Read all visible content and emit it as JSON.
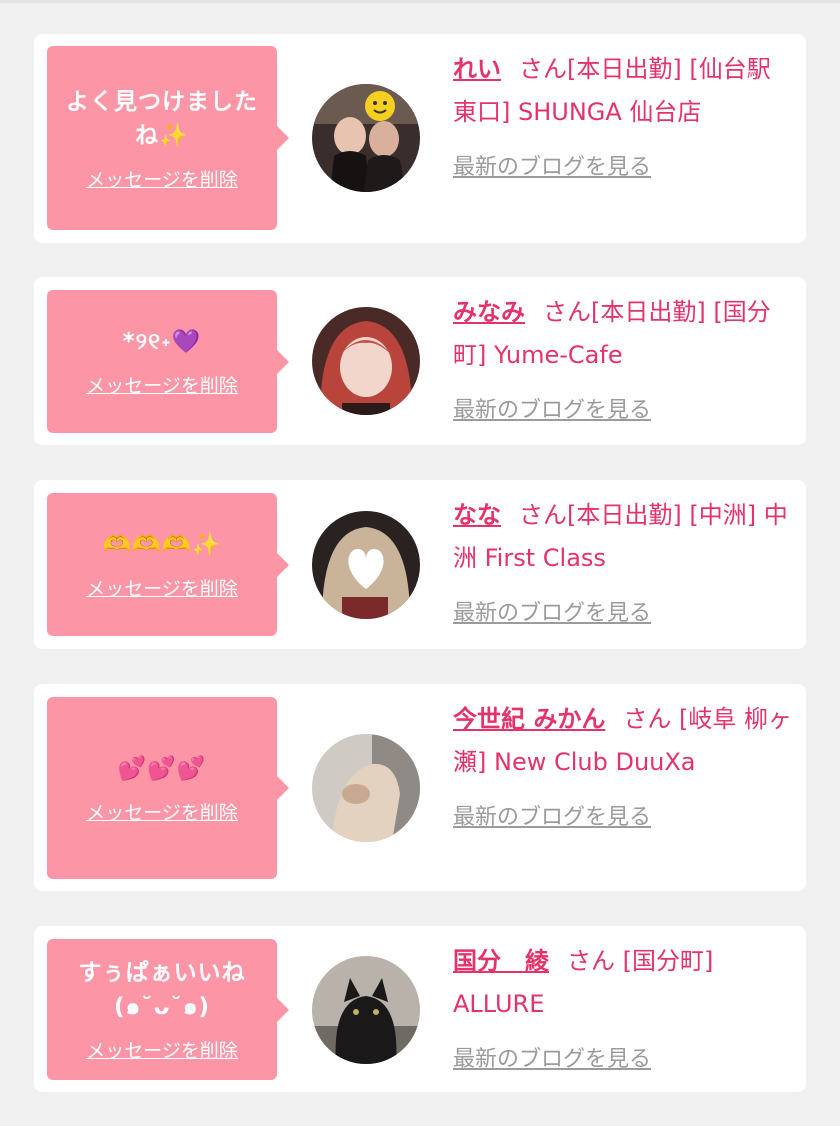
{
  "delete_label": "メッセージを削除",
  "blog_label": "最新のブログを見る",
  "san_label": "さん",
  "colors": {
    "bubble": "#fc96a6",
    "accent": "#e5336a",
    "link_gray": "#9b9b9b",
    "background": "#f0f0f0"
  },
  "cards": [
    {
      "message": "よく見つけましたね✨",
      "name": "れい",
      "status": "[本日出勤]",
      "shop": "[仙台駅東口] SHUNGA 仙台店"
    },
    {
      "message": "*୨୧˖💜",
      "name": "みなみ",
      "status": "[本日出勤]",
      "shop": "[国分町] Yume-Cafe"
    },
    {
      "message": "🫶🫶🫶✨",
      "name": "なな",
      "status": "[本日出勤]",
      "shop": "[中洲] 中洲 First Class"
    },
    {
      "message": "💕💕💕",
      "name": "今世紀 みかん",
      "status": "",
      "shop": "[岐阜 柳ヶ瀬] New Club DuuXa"
    },
    {
      "message": "すぅぱぁいいね(๑˘ᴗ˘๑)",
      "name": "国分　綾",
      "status": "",
      "shop": "[国分町] ALLURE"
    }
  ]
}
